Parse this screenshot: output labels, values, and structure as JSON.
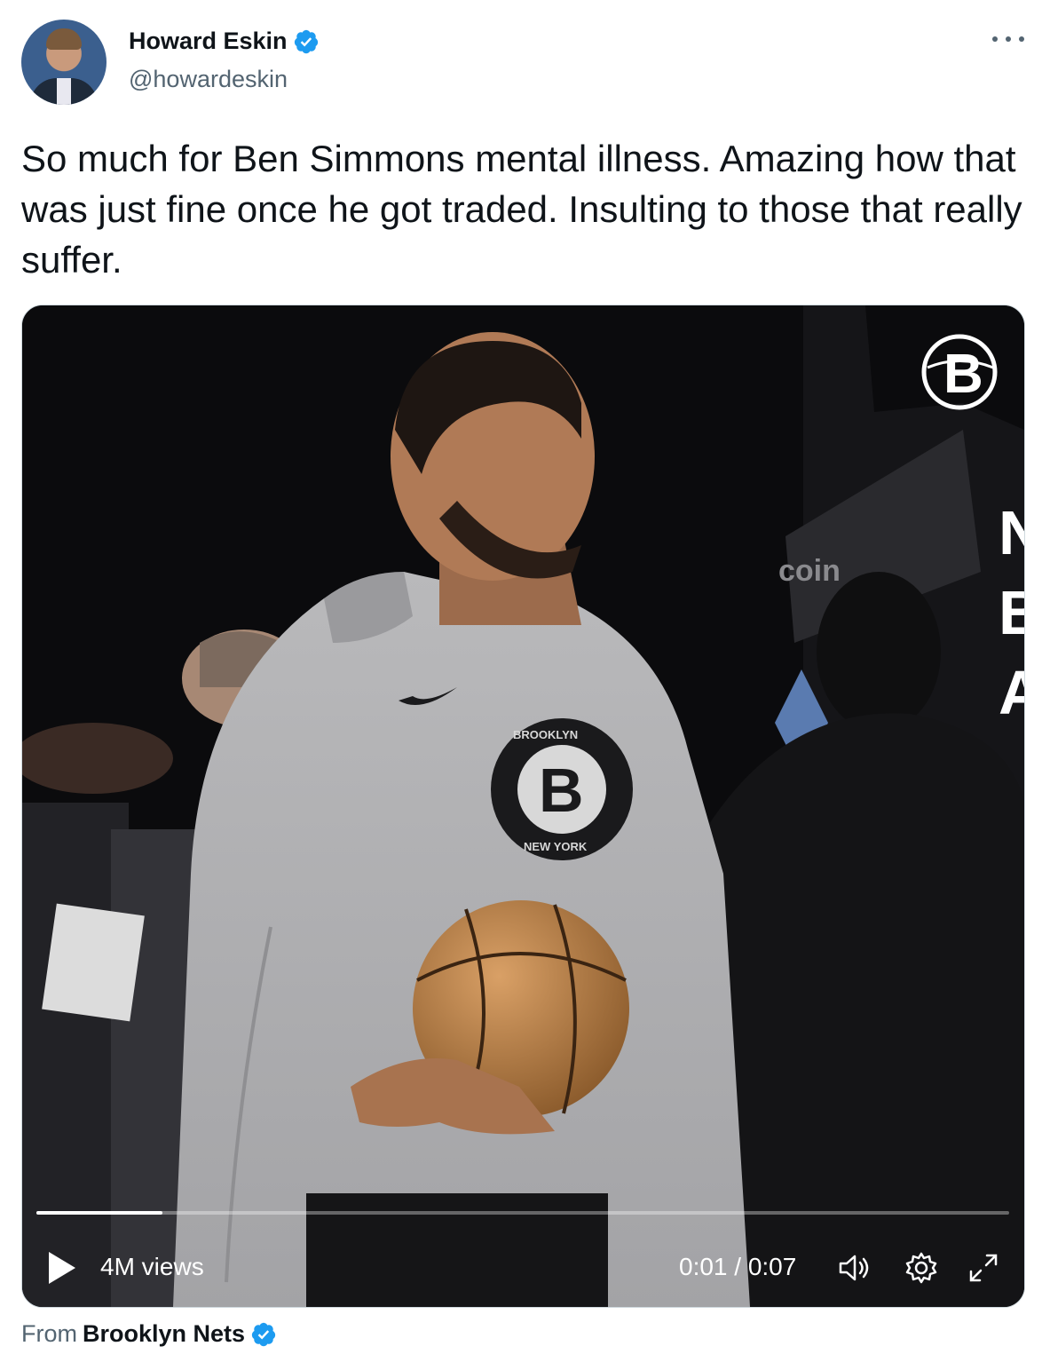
{
  "author": {
    "name": "Howard Eskin",
    "handle": "@howardeskin"
  },
  "tweet": {
    "text": "So much for Ben Simmons mental illness. Amazing how that was just fine once he got traded. Insulting to those that really suffer."
  },
  "video": {
    "views": "4M views",
    "time": "0:01 / 0:07",
    "progress_fraction": 0.13,
    "watermark_letter": "B",
    "banner_text": "NBA",
    "shirt_logo_top": "BROOKLYN",
    "shirt_logo_bottom": "NEW YORK",
    "court_sign": "coin"
  },
  "source": {
    "prefix": "From",
    "name": "Brooklyn Nets"
  },
  "colors": {
    "verified": "#1d9bf0",
    "text": "#0f1419",
    "muted": "#536471",
    "border": "#cfd9de"
  }
}
